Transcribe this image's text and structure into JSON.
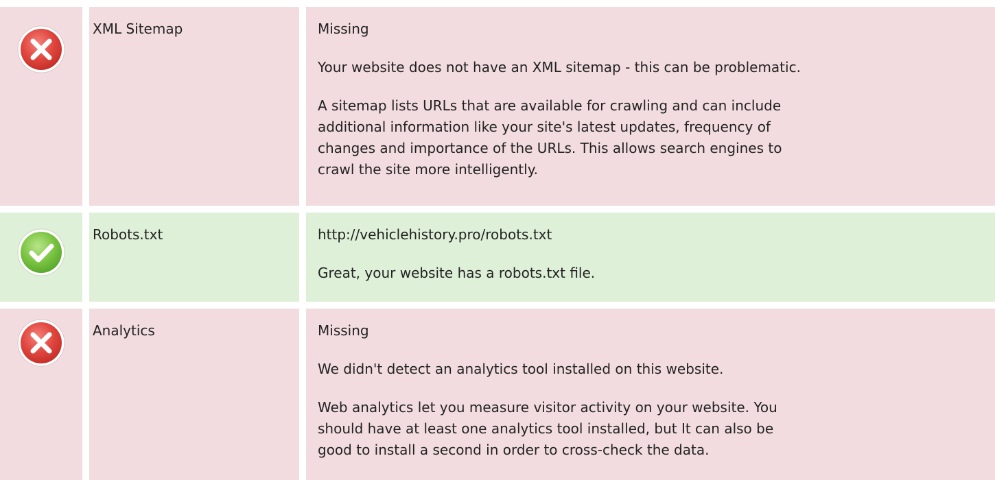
{
  "rows": [
    {
      "status": "fail",
      "icon": "error-x-icon",
      "label": "XML Sitemap",
      "value": "Missing",
      "paragraphs": [
        "Your website does not have an XML sitemap - this can be problematic.",
        "A sitemap lists URLs that are available for crawling and can include\nadditional information like your site's latest updates, frequency of\nchanges and importance of the URLs. This allows search engines to\ncrawl the site more intelligently."
      ]
    },
    {
      "status": "pass",
      "icon": "check-icon",
      "label": "Robots.txt",
      "value": "http://vehiclehistory.pro/robots.txt",
      "paragraphs": [
        "Great, your website has a robots.txt file."
      ]
    },
    {
      "status": "fail",
      "icon": "error-x-icon",
      "label": "Analytics",
      "value": "Missing",
      "paragraphs": [
        "We didn't detect an analytics tool installed on this website.",
        "Web analytics let you measure visitor activity on your website. You\nshould have at least one analytics tool installed, but It can also be\ngood to install a second in order to cross-check the data."
      ]
    }
  ],
  "colors": {
    "fail_bg": "#f2dcdf",
    "pass_bg": "#dff0d8",
    "fail_icon": "#e0463e",
    "pass_icon": "#6fbf3a"
  }
}
